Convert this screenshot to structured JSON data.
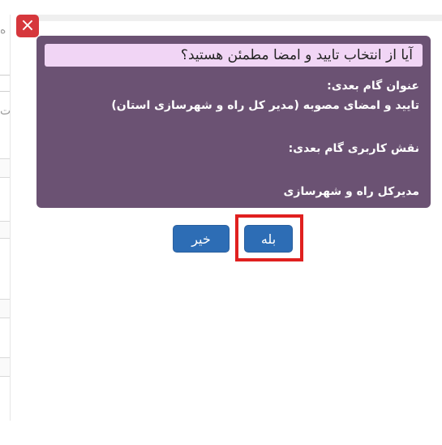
{
  "dialog": {
    "close_symbol": "×",
    "question": "آیا از انتخاب تایید و امضا مطمئن هستید؟",
    "next_step_title_label": "عنوان گام بعدی:",
    "next_step_title_value": "تایید و امضای مصوبه (مدیر کل راه و شهرسازی استان)",
    "next_step_role_label": "نقش کاربری گام بعدی:",
    "next_step_role_value": "مدیرکل راه و شهرسازی",
    "yes_label": "بله",
    "no_label": "خیر"
  },
  "background": {
    "glyph_top": "ه",
    "glyph_mid": "ت"
  },
  "colors": {
    "panel": "#6b5273",
    "question_bg": "#f1d5f5",
    "button": "#2d6db5",
    "close": "#d6373c",
    "highlight": "#e0201f"
  },
  "icons": {
    "close": "close-icon"
  }
}
